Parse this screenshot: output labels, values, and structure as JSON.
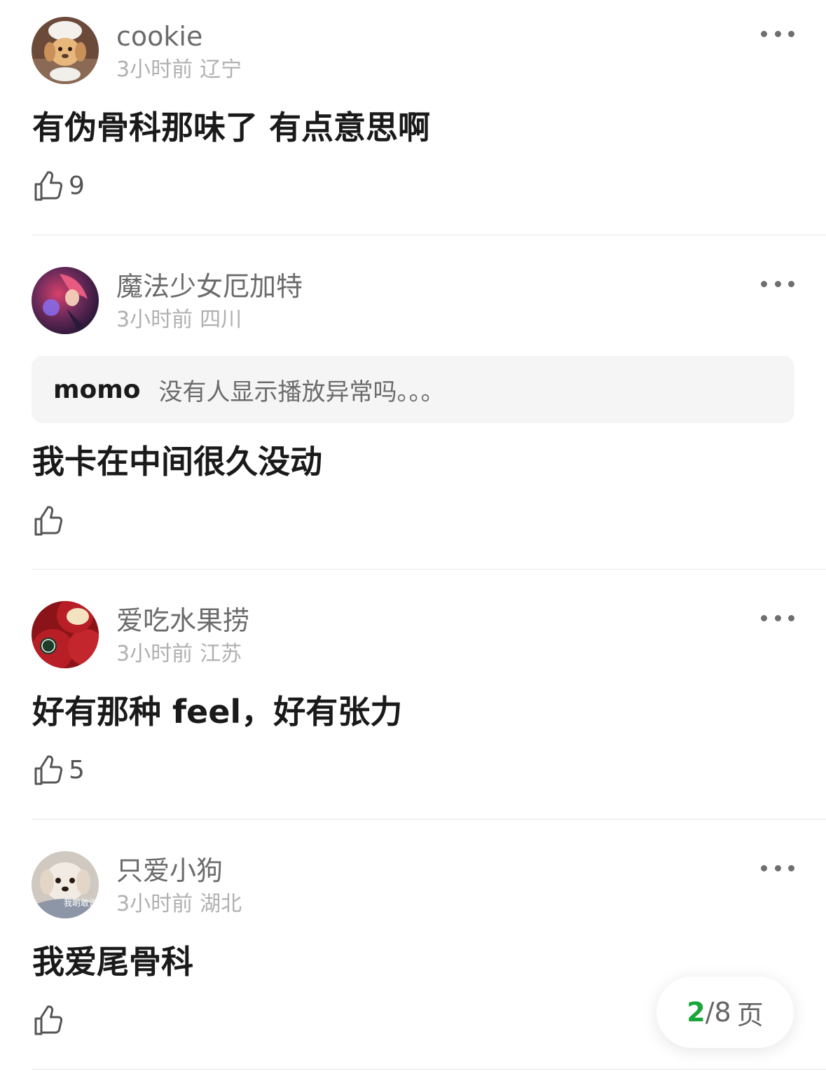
{
  "comments": [
    {
      "username": "cookie",
      "time": "3小时前",
      "location": "辽宁",
      "text": "有伪骨科那味了 有点意思啊",
      "likes": "9",
      "avatar_colors": {
        "bg": "#6b4a3a",
        "face": "#e8b77c",
        "hat": "#f4f1ec"
      }
    },
    {
      "username": "魔法少女厄加特",
      "time": "3小时前",
      "location": "四川",
      "quote_author": "momo",
      "quote_text": "没有人显示播放异常吗。。。",
      "text": "我卡在中间很久没动",
      "likes": "",
      "avatar_colors": {
        "bg": "#2a1a3a",
        "accent": "#d8406a",
        "glow": "#8a6cf0"
      }
    },
    {
      "username": "爱吃水果捞",
      "time": "3小时前",
      "location": "江苏",
      "text": "好有那种 feel，好有张力",
      "likes": "5",
      "avatar_colors": {
        "bg": "#b81e26",
        "flesh": "#f3e3c0",
        "label": "#1c3d2a"
      }
    },
    {
      "username": "只爱小狗",
      "time": "3小时前",
      "location": "湖北",
      "text": "我爱尾骨科",
      "likes": "",
      "avatar_overlay_text": "我啲敢说",
      "avatar_colors": {
        "bg": "#cfc9c2",
        "dog": "#f2ebe3",
        "cloth": "#8c96a6"
      }
    }
  ],
  "pager": {
    "current": "2",
    "total_text": "/8",
    "suffix": "页"
  },
  "icons": {
    "more": "more-dots-icon",
    "like": "thumbs-up-icon"
  },
  "colors": {
    "accent_green": "#1aa63a",
    "meta_gray": "#b0b0b0",
    "divider": "#e6e6e6"
  }
}
